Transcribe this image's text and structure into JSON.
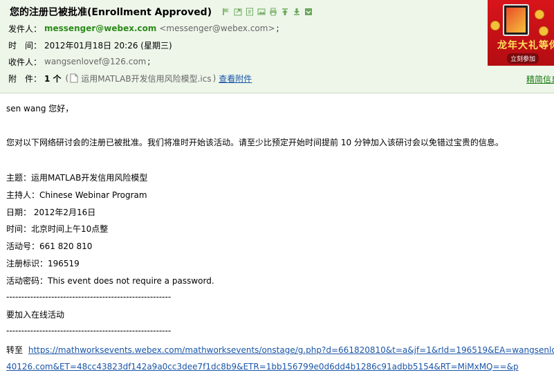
{
  "header": {
    "subject": "您的注册已被批准(Enrollment Approved)",
    "toolbar_icons": [
      "flag-icon",
      "reply-icon",
      "note-icon",
      "image-icon",
      "print-icon",
      "up-icon",
      "down-icon",
      "collapse-icon"
    ],
    "from_label": "发件人：",
    "from_name": "messenger@webex.com",
    "from_address": "<messenger@webex.com>",
    "from_suffix": ";",
    "time_label": "时　间：",
    "time_value": "2012年01月18日 20:26 (星期三)",
    "to_label": "收件人：",
    "to_value": "wangsenlovef@126.com",
    "to_suffix": ";",
    "attach_label": "附　件：",
    "attach_count": "1 个",
    "attach_open": "(",
    "attach_name": "运用MATLAB开发信用风险模型.ics",
    "attach_close": ")",
    "view_attach": "查看附件",
    "precise_info": "精简信息"
  },
  "ad": {
    "slogan": "龙年大礼等你",
    "cta": "立刻参加",
    "colors": {
      "bg": "#d8141b",
      "slogan": "#ffe05c"
    }
  },
  "body": {
    "greeting": "sen wang 您好，",
    "intro": "您对以下网络研讨会的注册已被批准。我们将准时开始该活动。请至少比预定开始时间提前 10 分钟加入该研讨会以免错过宝贵的信息。",
    "topic": "主题：运用MATLAB开发信用风险模型",
    "host": "主持人：Chinese Webinar Program",
    "date": "日期：  2012年2月16日",
    "time": "时间：北京时间上午10点整",
    "event_no": "活动号：661 820 810",
    "reg_id": "注册标识：196519",
    "event_pw": "活动密码：This event does not require a password.",
    "divider": "-------------------------------------------------------",
    "join_heading": "要加入在线活动",
    "go_to": "转至",
    "link_line1": "https://mathworksevents.webex.com/mathworksevents/onstage/g.php?d=661820810&t=a&jf=1&rId=196519&EA=wangsenlovef%",
    "link_line2": "40126.com&ET=48cc43823df142a9a0cc3dee7f1dc8b9&ETR=1bb156799e0d6dd4b1286c91adbb5154&RT=MiMxMQ==&p"
  },
  "colors": {
    "header_bg": "#eef6ea",
    "sender": "#2c8a1a",
    "link": "#1a55a8"
  }
}
